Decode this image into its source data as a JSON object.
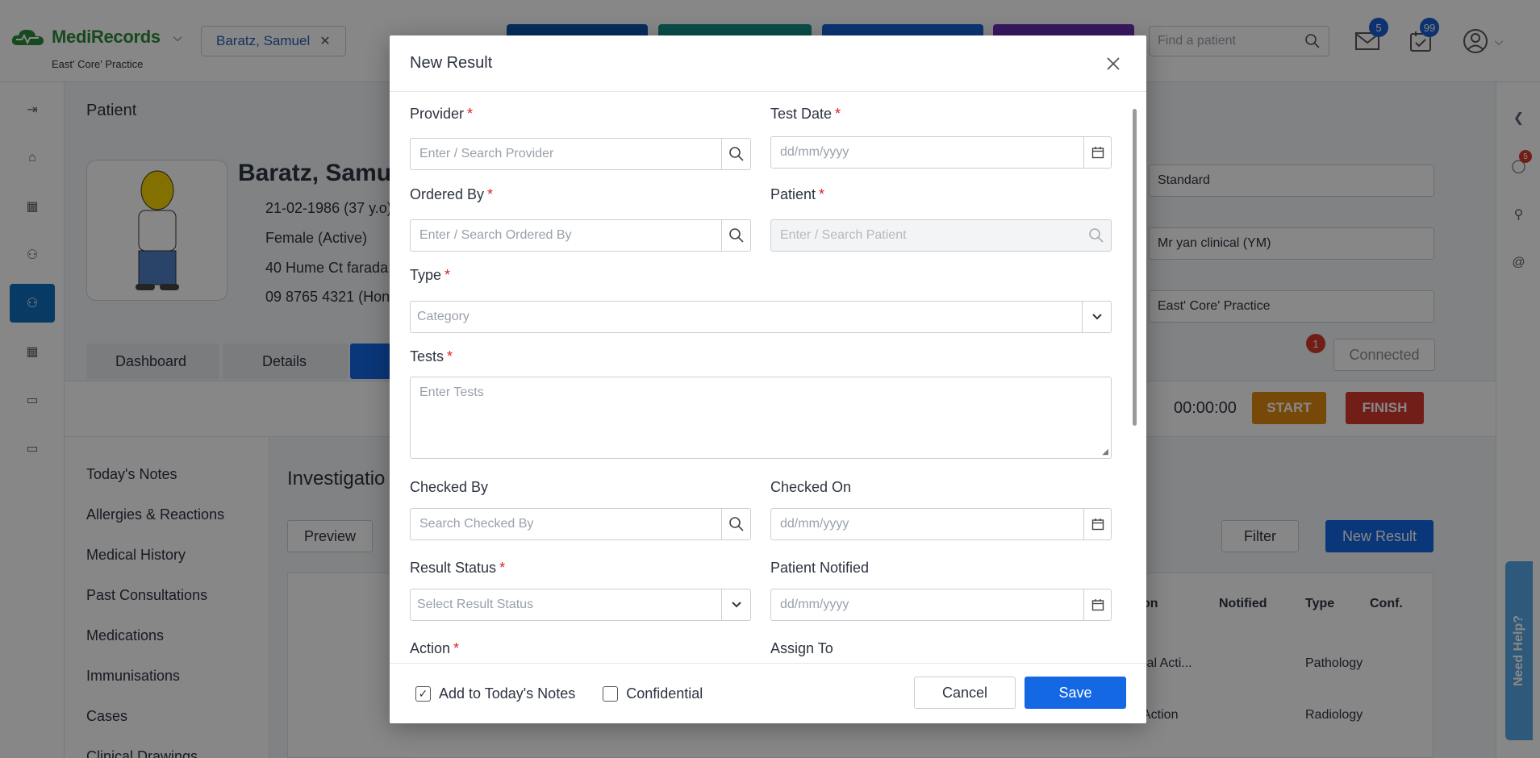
{
  "app": {
    "name": "MediRecords",
    "practice": "East' Core' Practice"
  },
  "header": {
    "patient_chip": "Baratz, Samuel",
    "search_placeholder": "Find a patient",
    "mail_count": "5",
    "tasks_count": "99"
  },
  "background": {
    "section_title": "Patient",
    "patient_name": "Baratz, Samu",
    "dob": "21-02-1986 (37 y.o)",
    "gender": "Female (Active)",
    "address": "40 Hume Ct farada",
    "phone": "09 8765 4321 (Hon",
    "tabs": [
      "Dashboard",
      "Details"
    ],
    "sidebar_menu": [
      "Today's Notes",
      "Allergies & Reactions",
      "Medical History",
      "Past Consultations",
      "Medications",
      "Immunisations",
      "Cases",
      "Clinical Drawings"
    ],
    "investigations_title": "Investigatio",
    "preview_label": "Preview",
    "filter_label": "Filter",
    "new_result_label": "New Result",
    "dropdown_standard": "Standard",
    "dropdown_clinician": "Mr yan clinical (YM)",
    "dropdown_practice": "East' Core' Practice",
    "connected_label": "Connected",
    "message_badge": "1",
    "chat_badge": "5",
    "timer": "00:00:00",
    "start_label": "START",
    "finish_label": "FINISH",
    "table_headers": [
      "on",
      "Notified",
      "Type",
      "Conf."
    ],
    "table_rows": [
      {
        "action": "ical Acti...",
        "type": "Pathology"
      },
      {
        "action": "Action",
        "type": "Radiology"
      }
    ],
    "need_help": "Need Help?"
  },
  "modal": {
    "title": "New Result",
    "fields": {
      "provider": {
        "label": "Provider",
        "placeholder": "Enter / Search Provider"
      },
      "test_date": {
        "label": "Test Date",
        "placeholder": "dd/mm/yyyy"
      },
      "ordered_by": {
        "label": "Ordered By",
        "placeholder": "Enter / Search Ordered By"
      },
      "patient": {
        "label": "Patient",
        "placeholder": "Enter / Search Patient"
      },
      "type": {
        "label": "Type",
        "placeholder": "Category"
      },
      "tests": {
        "label": "Tests",
        "placeholder": "Enter Tests"
      },
      "checked_by": {
        "label": "Checked By",
        "placeholder": "Search Checked By"
      },
      "checked_on": {
        "label": "Checked On",
        "placeholder": "dd/mm/yyyy"
      },
      "result_status": {
        "label": "Result Status",
        "placeholder": "Select Result Status"
      },
      "patient_notified": {
        "label": "Patient Notified",
        "placeholder": "dd/mm/yyyy"
      },
      "action": {
        "label": "Action"
      },
      "assign_to": {
        "label": "Assign To"
      }
    },
    "required_mark": "*",
    "footer": {
      "add_to_notes": "Add to Today's Notes",
      "add_to_notes_checked": true,
      "confidential": "Confidential",
      "confidential_checked": false,
      "cancel": "Cancel",
      "save": "Save"
    }
  },
  "colors": {
    "primary": "#1468e4",
    "brand": "#2c8a3a",
    "start": "#e08a12",
    "finish": "#d63a30",
    "required": "#dd2222"
  }
}
